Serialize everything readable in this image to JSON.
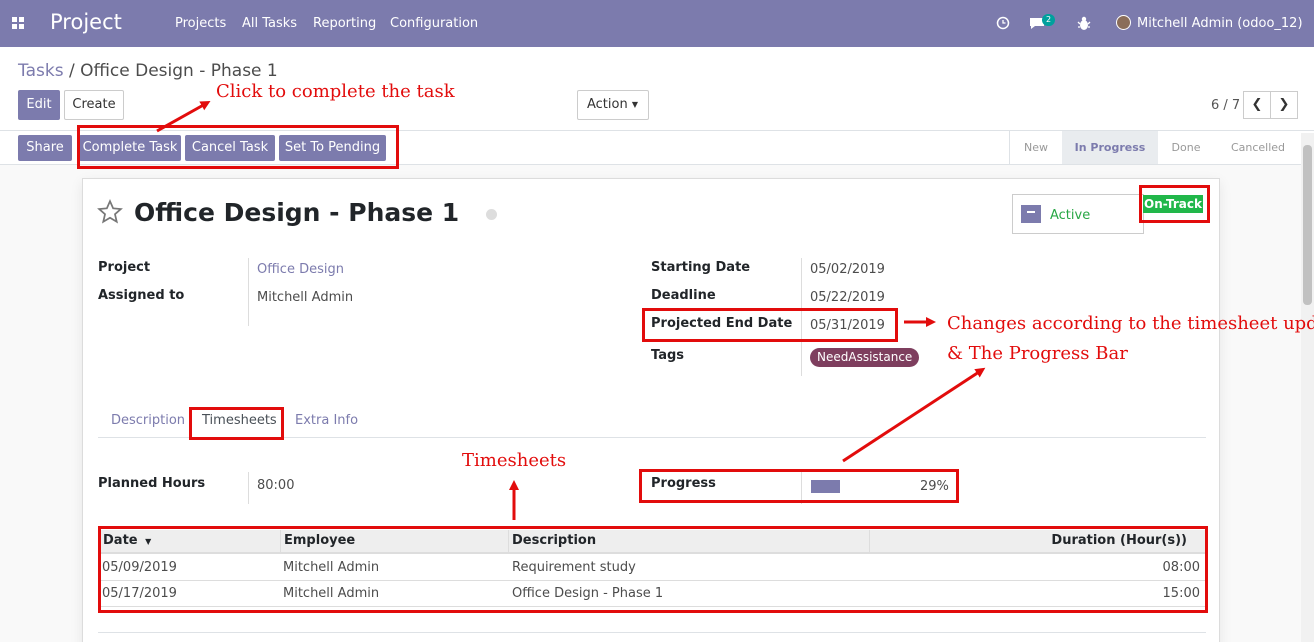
{
  "navbar": {
    "brand": "Project",
    "menu": [
      "Projects",
      "All Tasks",
      "Reporting",
      "Configuration"
    ],
    "message_count": "2",
    "user": "Mitchell Admin (odoo_12)"
  },
  "breadcrumb": {
    "parent": "Tasks",
    "separator": "/",
    "current": "Office Design - Phase 1"
  },
  "toolbar": {
    "edit": "Edit",
    "create": "Create",
    "action": "Action",
    "pager": "6 / 7"
  },
  "statusbar": {
    "buttons": [
      "Share",
      "Complete Task",
      "Cancel Task",
      "Set To Pending"
    ],
    "stages": [
      "New",
      "In Progress",
      "Done",
      "Cancelled"
    ],
    "active_stage": "In Progress"
  },
  "task": {
    "title": "Office Design - Phase 1",
    "active_label": "Active",
    "status_badge": "On-Track",
    "fields_left": [
      {
        "label": "Project",
        "value": "Office Design"
      },
      {
        "label": "Assigned to",
        "value": "Mitchell Admin"
      }
    ],
    "fields_right": [
      {
        "label": "Starting Date",
        "value": "05/02/2019"
      },
      {
        "label": "Deadline",
        "value": "05/22/2019"
      },
      {
        "label": "Projected End Date",
        "value": "05/31/2019"
      },
      {
        "label": "Tags",
        "value": "NeedAssistance"
      }
    ]
  },
  "tabs": [
    "Description",
    "Timesheets",
    "Extra Info"
  ],
  "timesheet": {
    "planned_hours_label": "Planned Hours",
    "planned_hours": "80:00",
    "progress_label": "Progress",
    "progress_value": "29%",
    "progress_fraction": 0.29,
    "columns": [
      "Date",
      "Employee",
      "Description",
      "Duration (Hour(s))"
    ],
    "rows": [
      [
        "05/09/2019",
        "Mitchell Admin",
        "Requirement study",
        "08:00"
      ],
      [
        "05/17/2019",
        "Mitchell Admin",
        "Office Design - Phase 1",
        "15:00"
      ]
    ]
  },
  "annotations": {
    "complete": "Click to complete the task",
    "changes_line1": "Changes according to the timesheet update",
    "changes_line2": "& The Progress Bar",
    "timesheets": "Timesheets"
  },
  "colors": {
    "primary": "#7c7bad",
    "annotation": "#e20c0c",
    "ontrack": "#21b74a",
    "tag": "#7e3e5e"
  }
}
